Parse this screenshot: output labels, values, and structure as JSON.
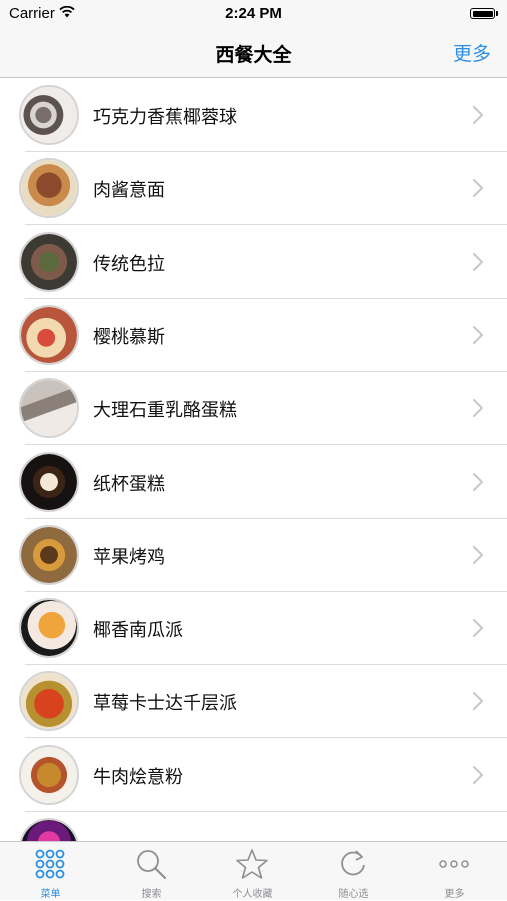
{
  "status_bar": {
    "carrier": "Carrier",
    "time": "2:24 PM",
    "wifi_icon": "wifi-icon",
    "battery_icon": "battery-icon"
  },
  "nav": {
    "title": "西餐大全",
    "more_label": "更多"
  },
  "accent_color": "#2d8fe3",
  "recipes": [
    {
      "name": "巧克力香蕉椰蓉球",
      "icon": "chevron-right-icon"
    },
    {
      "name": "肉酱意面",
      "icon": "chevron-right-icon"
    },
    {
      "name": "传统色拉",
      "icon": "chevron-right-icon"
    },
    {
      "name": "樱桃慕斯",
      "icon": "chevron-right-icon"
    },
    {
      "name": "大理石重乳酪蛋糕",
      "icon": "chevron-right-icon"
    },
    {
      "name": "纸杯蛋糕",
      "icon": "chevron-right-icon"
    },
    {
      "name": "苹果烤鸡",
      "icon": "chevron-right-icon"
    },
    {
      "name": "椰香南瓜派",
      "icon": "chevron-right-icon"
    },
    {
      "name": "草莓卡士达千层派",
      "icon": "chevron-right-icon"
    },
    {
      "name": "牛肉烩意粉",
      "icon": "chevron-right-icon"
    }
  ],
  "tabs": [
    {
      "label": "菜单",
      "icon": "grid-icon",
      "active": true
    },
    {
      "label": "搜索",
      "icon": "search-icon",
      "active": false
    },
    {
      "label": "个人收藏",
      "icon": "star-icon",
      "active": false
    },
    {
      "label": "随心选",
      "icon": "refresh-icon",
      "active": false
    },
    {
      "label": "更多",
      "icon": "more-dots-icon",
      "active": false
    }
  ]
}
